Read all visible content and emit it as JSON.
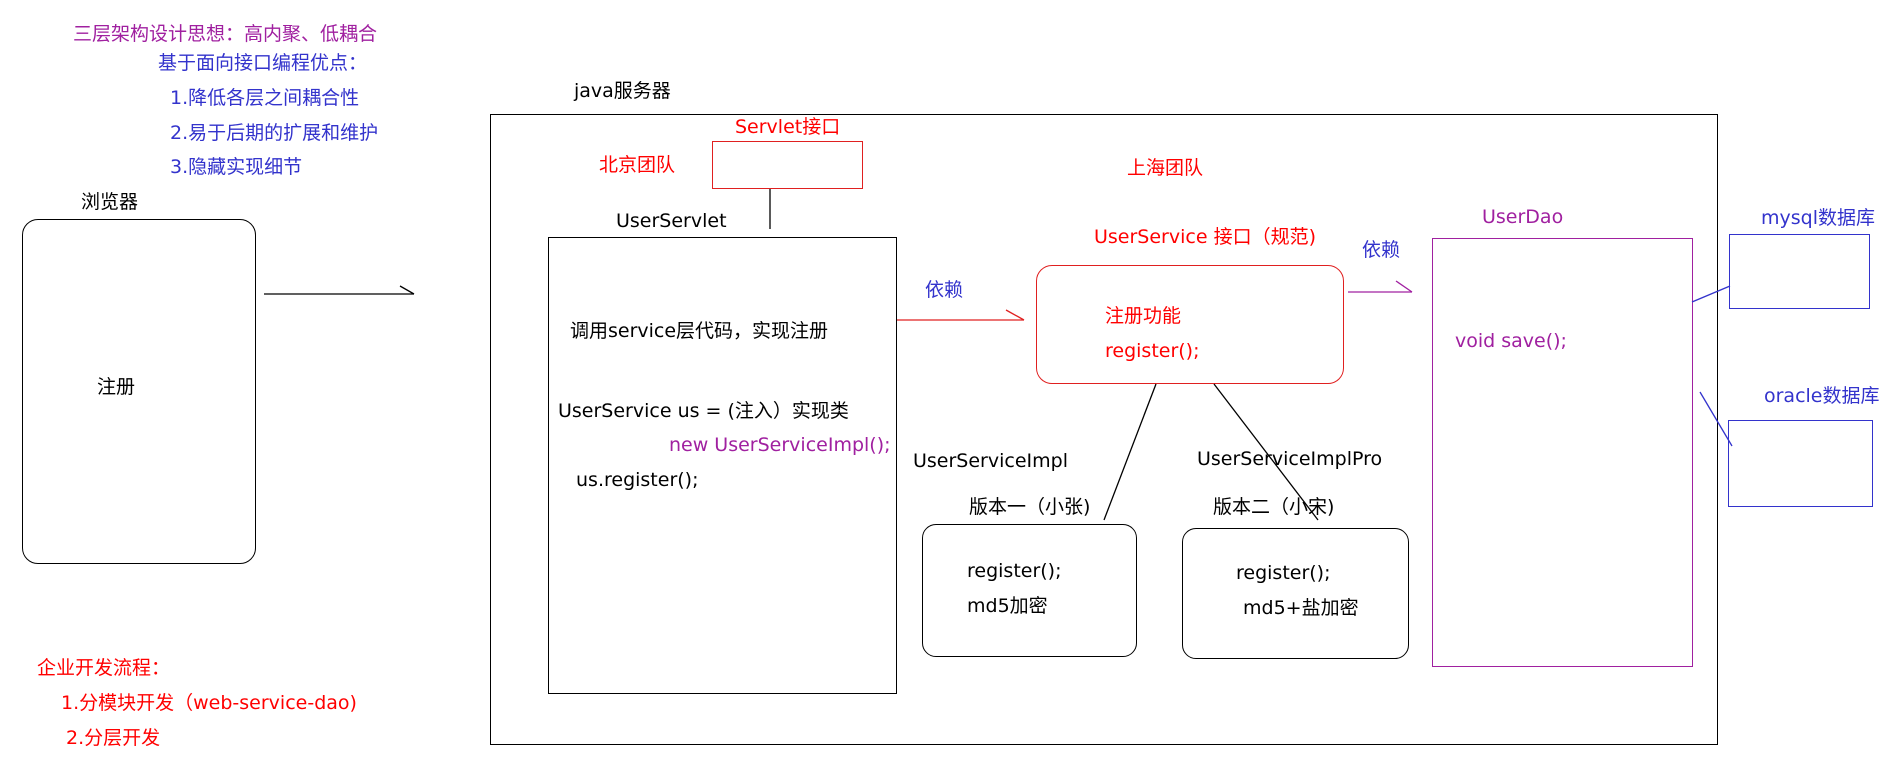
{
  "intro": {
    "heading": "三层架构设计思想：高内聚、低耦合",
    "subheading": "基于面向接口编程优点：",
    "points": [
      "1.降低各层之间耦合性",
      "2.易于后期的扩展和维护",
      "3.隐藏实现细节"
    ]
  },
  "browser": {
    "title": "浏览器",
    "content": "注册"
  },
  "server": {
    "title": "java服务器",
    "beijing_team": "北京团队",
    "shanghai_team": "上海团队",
    "servlet_interface": "Servlet接口"
  },
  "servlet": {
    "title": "UserServlet",
    "line1": "调用service层代码，实现注册",
    "line2": "UserService us =   (注入）实现类",
    "line3": "new UserServiceImpl();",
    "line4": "us.register();"
  },
  "service": {
    "title": "UserService 接口（规范)",
    "line1": "注册功能",
    "line2": "register();"
  },
  "impl1": {
    "name": "UserServiceImpl",
    "version": "版本一（小张)",
    "line1": "register();",
    "line2": "md5加密"
  },
  "impl2": {
    "name": "UserServiceImplPro",
    "version": "版本二（小宋)",
    "line1": "register();",
    "line2": "md5+盐加密"
  },
  "dao": {
    "title": "UserDao",
    "line1": "void save();"
  },
  "depends1": "依赖",
  "depends2": "依赖",
  "mysql": "mysql数据库",
  "oracle": "oracle数据库",
  "process": {
    "heading": "企业开发流程：",
    "points": [
      "1.分模块开发（web-service-dao)",
      "2.分层开发"
    ]
  },
  "colors": {
    "red": "#ff0000",
    "purple": "#a020a0",
    "blue": "#3333cc",
    "black": "#000000"
  }
}
